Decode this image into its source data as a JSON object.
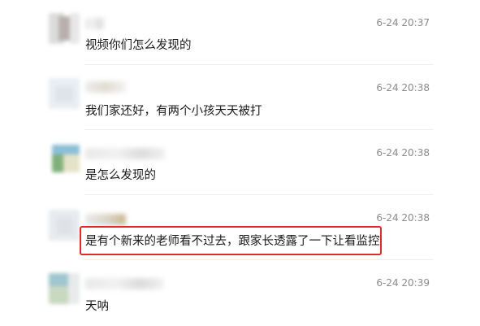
{
  "comments": [
    {
      "time": "6-24 20:37",
      "text": "视频你们怎么发现的",
      "avatar_colors": [
        "#dcdcdc",
        "#b9b0ad",
        "#e8e8e8"
      ]
    },
    {
      "time": "6-24 20:38",
      "text": "我们家还好，有两个小孩天天被打",
      "avatar_colors": [
        "#e9eef2",
        "#dde4ea",
        "#f1f3f5"
      ]
    },
    {
      "time": "6-24 20:38",
      "text": "是怎么发现的",
      "avatar_colors": [
        "#8bbfd6",
        "#7fb07a",
        "#e6e2c8"
      ]
    },
    {
      "time": "6-24 20:38",
      "text": "是有个新来的老师看不过去，跟家长透露了一下让看监控",
      "avatar_colors": [
        "#e7ebee",
        "#dfe3e6",
        "#f0f2f4"
      ],
      "highlighted": true
    },
    {
      "time": "6-24 20:39",
      "text": "天呐",
      "avatar_colors": [
        "#9fc7cf",
        "#c9d8c0",
        "#e8eaec"
      ]
    }
  ],
  "colors": {
    "highlight": "#e02b2b",
    "text": "#1a1a1a",
    "time": "#8a8a8a"
  }
}
